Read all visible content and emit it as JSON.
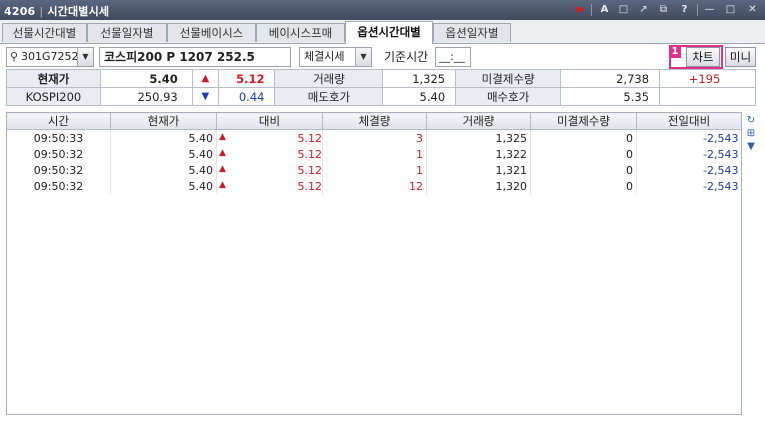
{
  "window": {
    "code": "4206",
    "title": "시간대별시세",
    "icons": [
      "play-icon",
      "font-icon",
      "new-window-icon",
      "link-icon",
      "copy-icon",
      "help-icon",
      "minimize-icon",
      "maximize-icon",
      "close-icon"
    ]
  },
  "tabs": [
    {
      "label": "선물시간대별",
      "active": false
    },
    {
      "label": "선물일자별",
      "active": false
    },
    {
      "label": "선물베이시스",
      "active": false
    },
    {
      "label": "베이시스프매",
      "active": false
    },
    {
      "label": "옵션시간대별",
      "active": true
    },
    {
      "label": "옵션일자별",
      "active": false
    }
  ],
  "controls": {
    "code_value": "301G7252",
    "instrument_name": "코스피200 P 1207 252.5",
    "type_select": "체결시세",
    "base_time_label": "기준시간",
    "base_time_value": "__:__",
    "badge": "1",
    "chart_button": "차트",
    "mini_button": "미니"
  },
  "summary": {
    "row1": {
      "label": "현재가",
      "price": "5.40",
      "change": "5.12",
      "volume_label": "거래량",
      "volume": "1,325",
      "oi_label": "미결제수량",
      "oi": "2,738",
      "oi_change": "+195"
    },
    "row2": {
      "label": "KOSPI200",
      "index": "250.93",
      "change": "0.44",
      "ask_label": "매도호가",
      "ask": "5.40",
      "bid_label": "매수호가",
      "bid": "5.35"
    }
  },
  "grid": {
    "headers": [
      "시간",
      "현재가",
      "대비",
      "체결량",
      "거래량",
      "미결제수량",
      "전일대비"
    ],
    "rows": [
      {
        "time": "09:50:33",
        "price": "5.40",
        "change": "5.12",
        "exec": "3",
        "volume": "1,325",
        "oi": "0",
        "prev": "-2,543"
      },
      {
        "time": "09:50:32",
        "price": "5.40",
        "change": "5.12",
        "exec": "1",
        "volume": "1,322",
        "oi": "0",
        "prev": "-2,543"
      },
      {
        "time": "09:50:32",
        "price": "5.40",
        "change": "5.12",
        "exec": "1",
        "volume": "1,321",
        "oi": "0",
        "prev": "-2,543"
      },
      {
        "time": "09:50:32",
        "price": "5.40",
        "change": "5.12",
        "exec": "12",
        "volume": "1,320",
        "oi": "0",
        "prev": "-2,543"
      }
    ]
  },
  "colors": {
    "up": "#d9181c",
    "down": "#1a3fb3",
    "highlight": "#e0308a"
  }
}
